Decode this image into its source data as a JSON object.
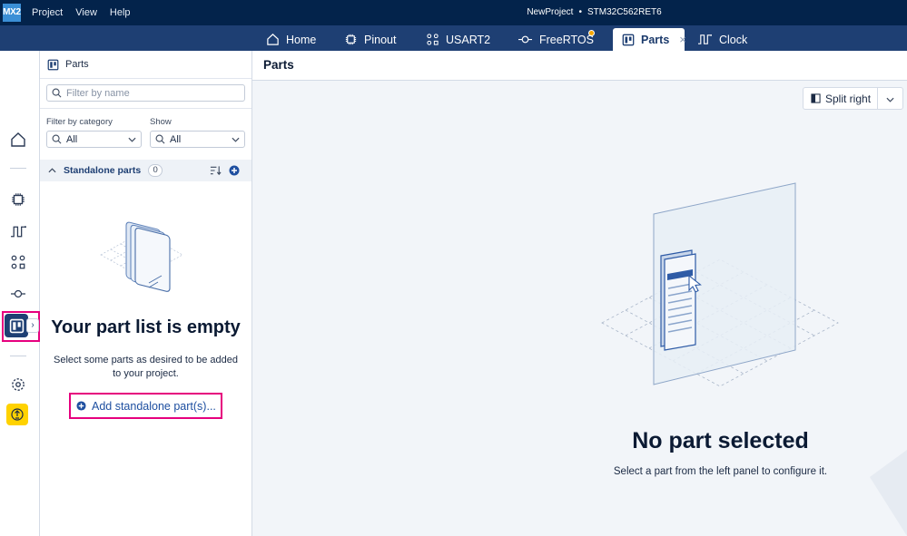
{
  "app": {
    "logo": "MX2",
    "menu": [
      "Project",
      "View",
      "Help"
    ],
    "project_name": "NewProject",
    "separator": "•",
    "device": "STM32C562RET6"
  },
  "tabs": [
    {
      "label": "Home",
      "icon": "home-icon"
    },
    {
      "label": "Pinout",
      "icon": "chip-icon"
    },
    {
      "label": "USART2",
      "icon": "peripheral-icon"
    },
    {
      "label": "FreeRTOS",
      "icon": "middleware-icon",
      "badge": "notification-dot"
    },
    {
      "label": "Parts",
      "icon": "parts-icon",
      "active": true,
      "closable": true,
      "close_glyph": "×"
    },
    {
      "label": "Clock",
      "icon": "clock-signal-icon"
    }
  ],
  "rail": {
    "icons": [
      "home-icon",
      "chip-icon",
      "clock-signal-icon",
      "peripheral-icon",
      "middleware-icon",
      "parts-icon",
      "settings-icon",
      "action-icon"
    ],
    "expand_glyph": "›"
  },
  "panel": {
    "title": "Parts",
    "search": {
      "placeholder": "Filter by name",
      "value": ""
    },
    "filter_category": {
      "label": "Filter by category",
      "value": "All"
    },
    "show": {
      "label": "Show",
      "value": "All"
    },
    "section": {
      "label": "Standalone parts",
      "count": "0"
    },
    "empty": {
      "title": "Your part list is empty",
      "text": "Select some parts as desired to be added to your project.",
      "action": "Add standalone part(s)..."
    }
  },
  "main": {
    "title": "Parts",
    "split_label": "Split right",
    "empty_title": "No part selected",
    "empty_text": "Select a part from the left panel to configure it."
  },
  "colors": {
    "titlebar": "#03234b",
    "tabbar": "#1e3f73",
    "accent": "#1e4fa0",
    "highlight": "#e6007e",
    "badge": "#f7a600",
    "action_yellow": "#ffd200"
  }
}
